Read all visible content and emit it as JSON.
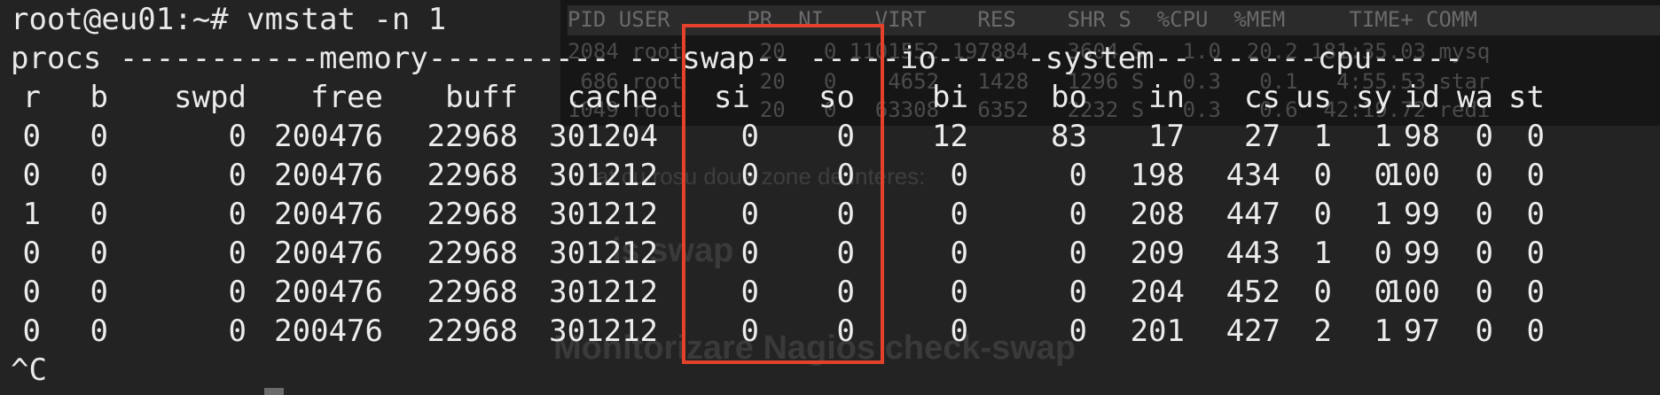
{
  "background": {
    "process_panel": {
      "header": "PID USER      PR  NI    VIRT    RES    SHR S  %CPU  %MEM     TIME+ COMM",
      "rows": [
        "2084 root      20   0 1101552 197884   3604 S   1.0  20.2 181:35.03 mysq",
        " 686 root      20   0    4652   1428   1296 S   0.3   0.1   4:55.53 star",
        "1049 root      20   0   63308   6352   2232 S   0.3   0.6  42:19.72 redi"
      ]
    },
    "article": {
      "caption": "at cu rosu doua zone de interes:",
      "heading1": "is swap",
      "heading2": "Monitorizare Nagios check-swap"
    }
  },
  "terminal": {
    "prompt": "root@eu01:~# vmstat -n 1",
    "group_header": "procs -----------memory---------- ---swap-- -----io---- -system-- ------cpu-----",
    "columns": [
      "r",
      "b",
      "swpd",
      "free",
      "buff",
      "cache",
      "si",
      "so",
      "bi",
      "bo",
      "in",
      "cs",
      "us",
      "sy",
      "id",
      "wa",
      "st"
    ],
    "rows": [
      [
        "0",
        "0",
        "0",
        "200476",
        "22968",
        "301204",
        "0",
        "0",
        "12",
        "83",
        "17",
        "27",
        "1",
        "1",
        "98",
        "0",
        "0"
      ],
      [
        "0",
        "0",
        "0",
        "200476",
        "22968",
        "301212",
        "0",
        "0",
        "0",
        "0",
        "198",
        "434",
        "0",
        "0",
        "100",
        "0",
        "0"
      ],
      [
        "1",
        "0",
        "0",
        "200476",
        "22968",
        "301212",
        "0",
        "0",
        "0",
        "0",
        "208",
        "447",
        "0",
        "1",
        "99",
        "0",
        "0"
      ],
      [
        "0",
        "0",
        "0",
        "200476",
        "22968",
        "301212",
        "0",
        "0",
        "0",
        "0",
        "209",
        "443",
        "1",
        "0",
        "99",
        "0",
        "0"
      ],
      [
        "0",
        "0",
        "0",
        "200476",
        "22968",
        "301212",
        "0",
        "0",
        "0",
        "0",
        "204",
        "452",
        "0",
        "0",
        "100",
        "0",
        "0"
      ],
      [
        "0",
        "0",
        "0",
        "200476",
        "22968",
        "301212",
        "0",
        "0",
        "0",
        "0",
        "201",
        "427",
        "2",
        "1",
        "97",
        "0",
        "0"
      ]
    ],
    "interrupt": "^C"
  },
  "highlight": {
    "color": "#e3412b",
    "target": "swap si/so columns"
  }
}
